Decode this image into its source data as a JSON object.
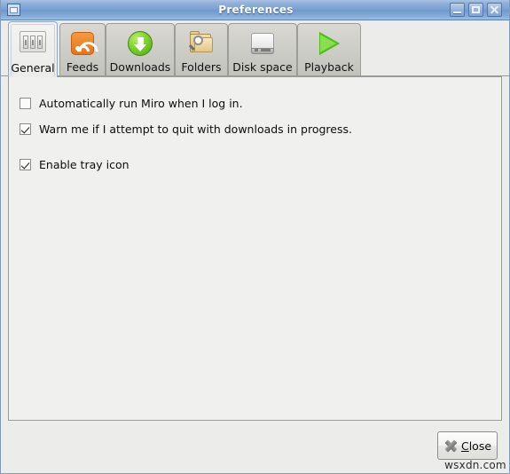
{
  "window": {
    "title": "Preferences",
    "icon": "window-icon",
    "controls": [
      {
        "name": "minimize",
        "glyph": "minimize-icon"
      },
      {
        "name": "maximize",
        "glyph": "maximize-icon"
      },
      {
        "name": "close",
        "glyph": "close-icon"
      }
    ]
  },
  "tabs": [
    {
      "label": "General",
      "icon": "switch-plate-icon",
      "selected": true
    },
    {
      "label": "Feeds",
      "icon": "rss-icon",
      "selected": false
    },
    {
      "label": "Downloads",
      "icon": "download-arrow-icon",
      "selected": false
    },
    {
      "label": "Folders",
      "icon": "folder-search-icon",
      "selected": false
    },
    {
      "label": "Disk space",
      "icon": "hard-drive-icon",
      "selected": false
    },
    {
      "label": "Playback",
      "icon": "play-triangle-icon",
      "selected": false
    }
  ],
  "general_panel": {
    "options": [
      {
        "label": "Automatically run Miro when I log in.",
        "checked": false
      },
      {
        "label": "Warn me if I attempt to quit with downloads in progress.",
        "checked": true
      },
      {
        "label": "Enable tray icon",
        "checked": true
      }
    ]
  },
  "footer": {
    "close_button": {
      "mnemonic": "C",
      "rest": "lose",
      "icon": "close-x-icon"
    },
    "watermark": "wsxdn.com"
  },
  "colors": {
    "titlebar_blue": "#7aa0d3",
    "window_bg": "#ececeb",
    "panel_bg": "#f0f0ee",
    "tab_bg": "#ccccc6",
    "accent_orange": "#e2751a",
    "accent_green": "#4cc016"
  }
}
